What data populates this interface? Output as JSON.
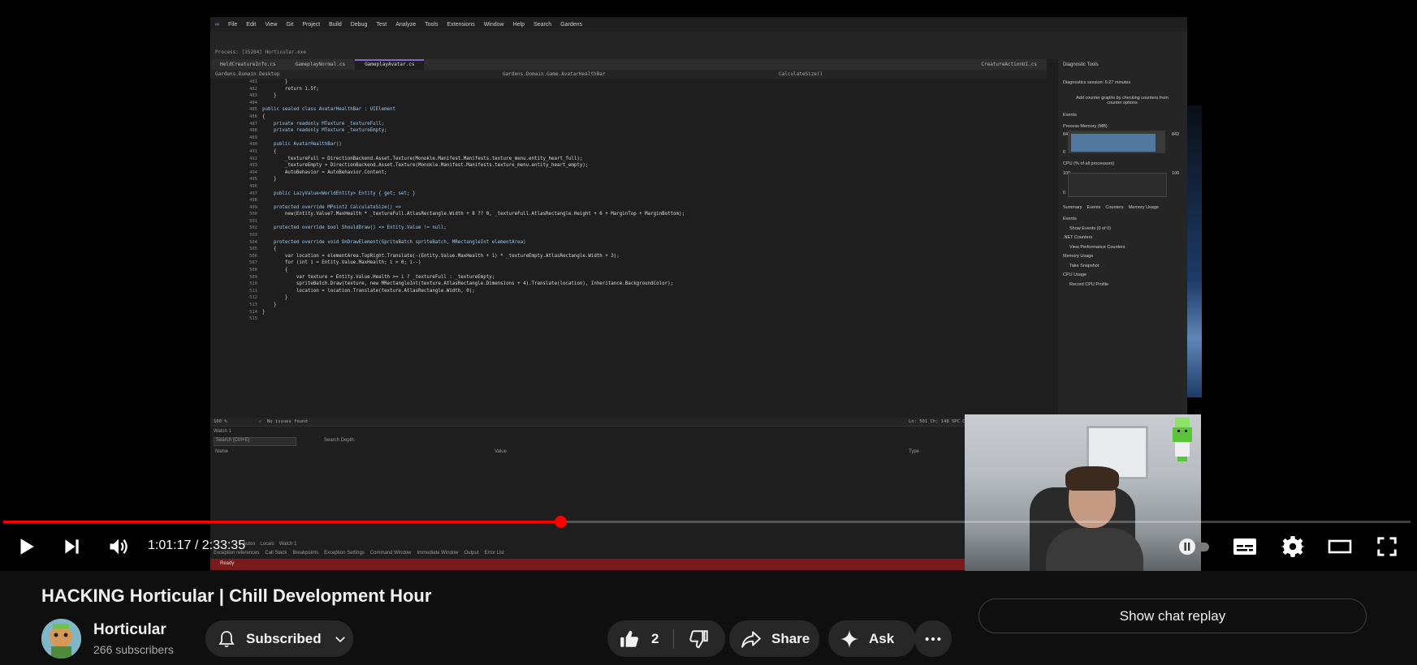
{
  "video": {
    "title": "HACKING Horticular | Chill Development Hour",
    "current_time": "1:01:17",
    "duration": "2:33:35",
    "time_display": "1:01:17 / 2:33:35",
    "progress_fraction": 0.396
  },
  "ide": {
    "menu": [
      "File",
      "Edit",
      "View",
      "Git",
      "Project",
      "Build",
      "Debug",
      "Test",
      "Analyze",
      "Tools",
      "Extensions",
      "Window",
      "Help",
      "Search",
      "Gardens"
    ],
    "process": "Process: [35284] Horticular.exe",
    "tabs": [
      "HeldCreatureInfo.cs",
      "GameplayNormal.cs",
      "GameplayAvatar.cs"
    ],
    "nav": [
      "Gardens.Domain.Desktop",
      "Gardens.Domain.Game.AvatarHealthBar",
      "CalculateSize()"
    ],
    "right_tab": "CreatureActionUI.cs",
    "line_numbers": [
      "481",
      "482",
      "483",
      "484",
      "485",
      "486",
      "487",
      "488",
      "489",
      "490",
      "491",
      "492",
      "493",
      "494",
      "495",
      "496",
      "497",
      "498",
      "499",
      "500",
      "501",
      "502",
      "503",
      "504",
      "505",
      "506",
      "507",
      "508",
      "509",
      "510",
      "511",
      "512",
      "513",
      "514",
      "515"
    ],
    "code": [
      "        }",
      "        return 1.5f;",
      "    }",
      "",
      "public sealed class AvatarHealthBar : UIElement",
      "{",
      "    private readonly MTexture _textureFull;",
      "    private readonly MTexture _textureEmpty;",
      "",
      "    public AvatarHealthBar()",
      "    {",
      "        _textureFull = DirectionBackend.Asset.Texture(Monokle.Manifest.Manifests.texture_menu.entity_heart_full);",
      "        _textureEmpty = DirectionBackend.Asset.Texture(Monokle.Manifest.Manifests.texture_menu.entity_heart_empty);",
      "        AutoBehavior = AutoBehavior.Content;",
      "    }",
      "",
      "    public LazyValue<WorldEntity> Entity { get; set; }",
      "",
      "    protected override MPoint2 CalculateSize() =>",
      "        new(Entity.Value?.MaxHealth * _textureFull.AtlasRectangle.Width + 8 ?? 0, _textureFull.AtlasRectangle.Height + 6 + MarginTop + MarginBottom);",
      "",
      "    protected override bool ShouldDraw() => Entity.Value != null;",
      "",
      "    protected override void OnDrawElement(SpriteBatch spriteBatch, MRectangleInt elementArea)",
      "    {",
      "        var location = elementArea.TopRight.Translate(-(Entity.Value.MaxHealth + 1) * _textureEmpty.AtlasRectangle.Width + 3);",
      "        for (int i = Entity.Value.MaxHealth; i > 0; i--)",
      "        {",
      "            var texture = Entity.Value.Health >= i ? _textureFull : _textureEmpty;",
      "            spriteBatch.Draw(texture, new MRectangleInt(texture.AtlasRectangle.Dimensions + 4).Translate(location), Inheritance.BackgroundColor);",
      "            location = location.Translate(texture.AtlasRectangle.Width, 0);",
      "        }",
      "    }",
      "}",
      ""
    ],
    "status_left": "100 %",
    "status_issues": "No issues found",
    "status_right": "Ln: 501   Ch: 148   SPC   CRLF",
    "diag": {
      "title": "Diagnostic Tools",
      "session": "Diagnostics session: 6:27 minutes",
      "hint": "Add counter graphs by checking counters from counter options",
      "events": "Events",
      "memory": "Process Memory (MB)",
      "mem_max": "842",
      "mem_min": "0",
      "cpu": "CPU (% of all processors)",
      "cpu_max": "100",
      "cpu_min": "0",
      "tabs": [
        "Summary",
        "Events",
        "Counters",
        "Memory Usage"
      ],
      "items": [
        "Events",
        "Show Events (0 of 0)",
        ".NET Counters",
        "View Performance Counters",
        "Memory Usage",
        "Take Snapshot",
        "CPU Usage",
        "Record CPU Profile"
      ]
    },
    "watch": {
      "title": "Watch 1",
      "search": "Search (Ctrl+E)",
      "search_depth": "Search Depth:",
      "cols": [
        "Name",
        "Value",
        "Type"
      ],
      "bottom_tabs": [
        "Autos",
        "Locals",
        "Watch 1"
      ],
      "bottom_tabs2": [
        "Exception references",
        "Call Stack",
        "Breakpoints",
        "Exception Settings",
        "Command Window",
        "Immediate Window",
        "Output",
        "Error List"
      ],
      "ready": "Ready"
    }
  },
  "channel": {
    "name": "Horticular",
    "subscribers": "266 subscribers"
  },
  "actions": {
    "subscribed": "Subscribed",
    "likes": "2",
    "share": "Share",
    "ask": "Ask",
    "chat_replay": "Show chat replay"
  },
  "icons": {
    "play": "play-icon",
    "next": "next-icon",
    "volume": "volume-icon",
    "pause_toggle": "autoplay-toggle-icon",
    "captions": "subtitles-icon",
    "settings": "gear-icon",
    "theater": "theater-icon",
    "fullscreen": "fullscreen-icon",
    "bell": "bell-icon",
    "like": "thumbs-up-icon",
    "dislike": "thumbs-down-icon",
    "share": "share-icon",
    "ask": "sparkle-icon",
    "more": "more-icon"
  },
  "colors": {
    "progress": "#ff0000",
    "background": "#0f0f0f",
    "pill": "#272727"
  }
}
